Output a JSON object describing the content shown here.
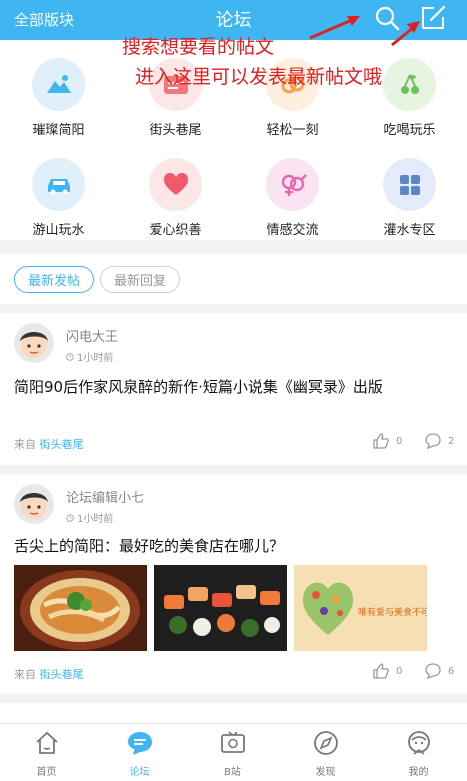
{
  "header": {
    "left_label": "全部版块",
    "title": "论坛"
  },
  "annotations": {
    "note_1": "搜索想要看的帖文",
    "note_2": "进入这里可以发表最新帖文哦",
    "color": "#e02020"
  },
  "categories": [
    {
      "label": "璀璨简阳",
      "icon": "mountain-landscape-icon",
      "bg": "#dff0fb",
      "color": "#3fb6f2"
    },
    {
      "label": "街头巷尾",
      "icon": "card-icon",
      "bg": "#fde6e6",
      "color": "#f07a7a"
    },
    {
      "label": "轻松一刻",
      "icon": "chain-link-icon",
      "bg": "#fdeedd",
      "color": "#f6a14b"
    },
    {
      "label": "吃喝玩乐",
      "icon": "cherry-icon",
      "bg": "#e6f5e2",
      "color": "#6cc15b"
    },
    {
      "label": "游山玩水",
      "icon": "car-icon",
      "bg": "#dff0fb",
      "color": "#3fb6f2"
    },
    {
      "label": "爱心织善",
      "icon": "heart-icon",
      "bg": "#fde6e6",
      "color": "#f05a6a"
    },
    {
      "label": "情感交流",
      "icon": "gender-symbols-icon",
      "bg": "#fbe4f2",
      "color": "#e767b3"
    },
    {
      "label": "灌水专区",
      "icon": "grid-icon",
      "bg": "#e3ecf8",
      "color": "#5b86c7"
    }
  ],
  "tabs": {
    "new_posts": "最新发帖",
    "new_replies": "最新回复"
  },
  "posts": [
    {
      "author": "闪电大王",
      "time": "1小时前",
      "title": "简阳90后作家风泉醉的新作·短篇小说集《幽冥录》出版",
      "from_label": "来自",
      "source": "街头巷尾",
      "likes": "0",
      "comments": "2"
    },
    {
      "author": "论坛编辑小七",
      "time": "1小时前",
      "title": "舌尖上的简阳：最好吃的美食店在哪儿？",
      "from_label": "来自",
      "source": "街头巷尾",
      "likes": "0",
      "comments": "6",
      "thumb_3_caption": "唯有爱与美食不可"
    }
  ],
  "bottom_nav": [
    {
      "label": "首页",
      "icon": "home-icon",
      "active": false
    },
    {
      "label": "论坛",
      "icon": "forum-chat-icon",
      "active": true
    },
    {
      "label": "B站",
      "icon": "tv-icon",
      "active": false
    },
    {
      "label": "发现",
      "icon": "compass-icon",
      "active": false
    },
    {
      "label": "我的",
      "icon": "profile-icon",
      "active": false
    }
  ],
  "colors": {
    "brand": "#3fb6f2",
    "background": "#f2f2f2"
  }
}
